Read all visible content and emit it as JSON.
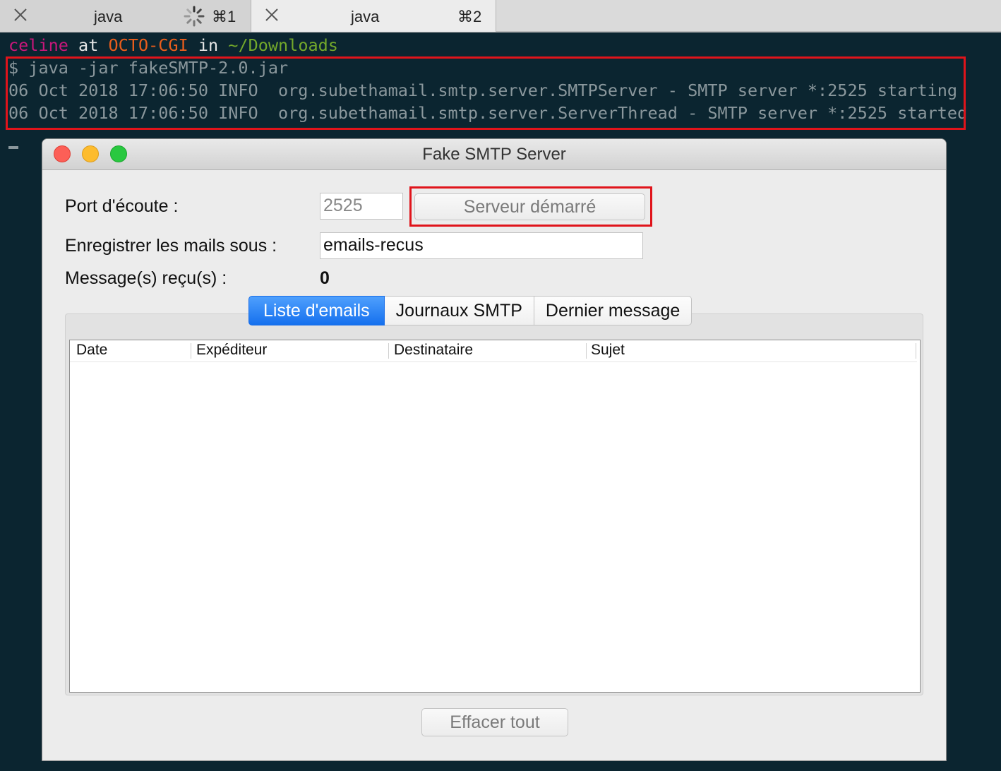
{
  "tabs": [
    {
      "title": "java",
      "shortcut": "⌘1",
      "busy": true
    },
    {
      "title": "java",
      "shortcut": "⌘2",
      "busy": false
    }
  ],
  "terminal": {
    "prompt": {
      "user": "celine",
      "at": "at",
      "host": "OCTO-CGI",
      "in": "in",
      "path": "~/Downloads"
    },
    "lines": [
      "$ java -jar fakeSMTP-2.0.jar",
      "06 Oct 2018 17:06:50 INFO  org.subethamail.smtp.server.SMTPServer - SMTP server *:2525 starting",
      "06 Oct 2018 17:06:50 INFO  org.subethamail.smtp.server.ServerThread - SMTP server *:2525 started"
    ]
  },
  "app": {
    "title": "Fake SMTP Server",
    "port_label": "Port d'écoute :",
    "port_value": "2525",
    "server_button": "Serveur démarré",
    "save_label": "Enregistrer les mails sous :",
    "save_value": "emails-recus",
    "received_label": "Message(s) reçu(s) :",
    "received_count": "0",
    "tabs": [
      "Liste d'emails",
      "Journaux SMTP",
      "Dernier message"
    ],
    "active_tab": 0,
    "columns": [
      "Date",
      "Expéditeur",
      "Destinataire",
      "Sujet"
    ],
    "clear_button": "Effacer tout"
  },
  "colors": {
    "terminal_bg": "#0b2530",
    "highlight": "#e0141b",
    "tab_active": "#1570ee"
  }
}
